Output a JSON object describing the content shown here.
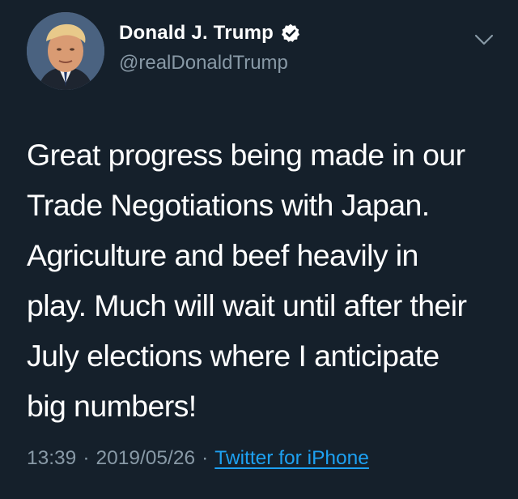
{
  "tweet": {
    "author": {
      "display_name": "Donald J. Trump",
      "handle": "@realDonaldTrump",
      "verified_icon": "verified-badge-icon",
      "avatar_icon": "avatar"
    },
    "menu_icon": "chevron-down-icon",
    "text_lines": [
      "Great progress being made in our",
      "Trade Negotiations with Japan.",
      "Agriculture and beef heavily in",
      "play. Much will wait until after their",
      "July elections where I anticipate",
      "big numbers!"
    ],
    "time": "13:39",
    "separator": "·",
    "date": "2019/05/26",
    "source": "Twitter for iPhone"
  },
  "colors": {
    "background": "#15202b",
    "primary_text": "#ffffff",
    "secondary_text": "#8899a6",
    "link": "#1da1f2"
  }
}
